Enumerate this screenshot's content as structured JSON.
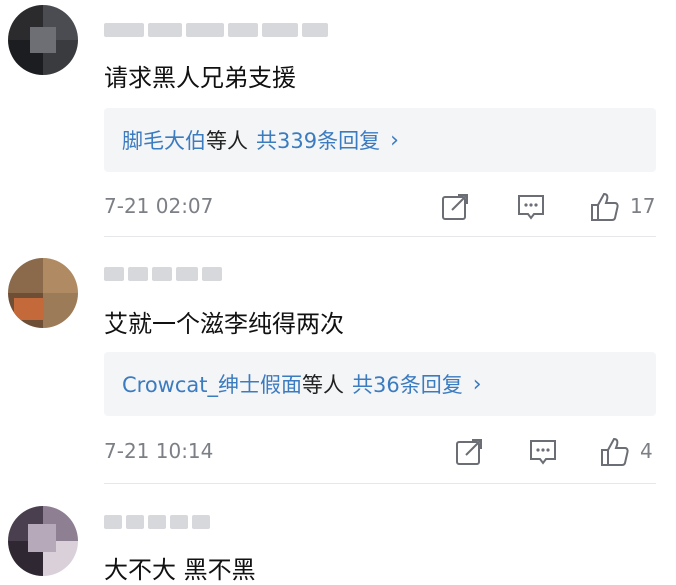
{
  "comments": [
    {
      "text": "请求黑人兄弟支援",
      "reply_names": "脚毛大伯",
      "reply_mid": "等人",
      "reply_count": "共339条回复",
      "reply_chevron": "›",
      "time": "7-21 02:07",
      "likes": "17",
      "avatar_colors": [
        "#2b2b2e",
        "#4a4c52",
        "#1c1d20",
        "#6d6f74",
        "#3a3b3f",
        "#909399"
      ]
    },
    {
      "text": "艾就一个滋李纯得两次",
      "reply_names": "Crowcat_绅士假面",
      "reply_mid": "等人",
      "reply_count": "共36条回复",
      "reply_chevron": "›",
      "time": "7-21 10:14",
      "likes": "4",
      "avatar_colors": [
        "#8a6a4a",
        "#b08a62",
        "#6e4f35",
        "#c46a3a",
        "#9c7b58",
        "#5a4532"
      ]
    },
    {
      "text": "大不大 黑不黑",
      "avatar_colors": [
        "#4a3f4e",
        "#8e7f93",
        "#2f2833",
        "#b6a9b9",
        "#6a5c6e",
        "#d9d0da"
      ]
    }
  ],
  "icons": {
    "share": "share-icon",
    "comment": "comment-icon",
    "like": "thumbs-up-icon"
  }
}
